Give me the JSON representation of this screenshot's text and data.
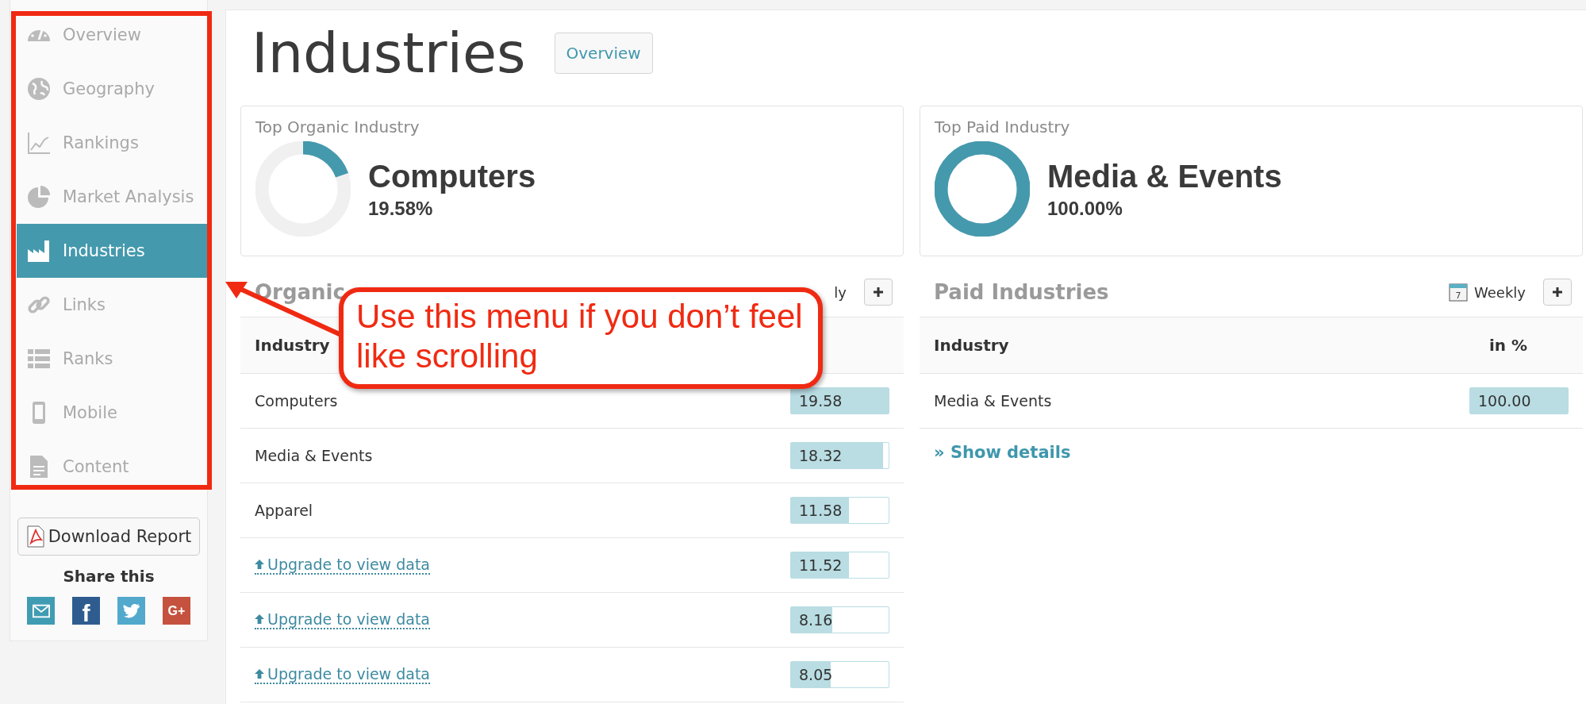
{
  "sidebar": {
    "items": [
      {
        "label": "Overview",
        "selected": false
      },
      {
        "label": "Geography",
        "selected": false
      },
      {
        "label": "Rankings",
        "selected": false
      },
      {
        "label": "Market Analysis",
        "selected": false
      },
      {
        "label": "Industries",
        "selected": true
      },
      {
        "label": "Links",
        "selected": false
      },
      {
        "label": "Ranks",
        "selected": false
      },
      {
        "label": "Mobile",
        "selected": false
      },
      {
        "label": "Content",
        "selected": false
      }
    ],
    "download_button": "Download Report",
    "share_title": "Share this",
    "share": [
      {
        "kind": "email",
        "color": "#3f9cb3"
      },
      {
        "kind": "text",
        "label": "f",
        "color": "#2f5c8f"
      },
      {
        "kind": "twitter",
        "color": "#52a9cc"
      },
      {
        "kind": "text",
        "label": "G+",
        "color": "#c5523f"
      }
    ]
  },
  "header": {
    "title": "Industries",
    "button": "Overview"
  },
  "cards": [
    {
      "title": "Top Organic Industry",
      "name": "Computers",
      "percent": "19.58%",
      "level": 0.1958
    },
    {
      "title": "Top Paid Industry",
      "name": "Media & Events",
      "percent": "100.00%",
      "level": 1
    }
  ],
  "sections": [
    {
      "title": "Organic",
      "period": "ly",
      "columns": [
        "Industry"
      ],
      "rows": [
        {
          "kind": "plain",
          "label": "Computers",
          "value": "19.58",
          "level": 1
        },
        {
          "kind": "plain",
          "label": "Media & Events",
          "value": "18.32",
          "level": 0.94
        },
        {
          "kind": "plain",
          "label": "Apparel",
          "value": "11.58",
          "level": 0.59
        },
        {
          "kind": "upgrade",
          "label": "Upgrade to view data",
          "value": "11.52",
          "level": 0.59
        },
        {
          "kind": "upgrade",
          "label": "Upgrade to view data",
          "value": "8.16",
          "level": 0.42
        },
        {
          "kind": "upgrade",
          "label": "Upgrade to view data",
          "value": "8.05",
          "level": 0.41
        }
      ]
    },
    {
      "title": "Paid Industries",
      "period": "Weekly",
      "calendar_day": "7",
      "columns": [
        "Industry",
        "in %"
      ],
      "rows": [
        {
          "kind": "plain",
          "label": "Media & Events",
          "value": "100.00",
          "level": 1
        }
      ],
      "more": "» Show details"
    }
  ],
  "callout": {
    "text": "Use this menu if you don’t feel like scrolling"
  }
}
